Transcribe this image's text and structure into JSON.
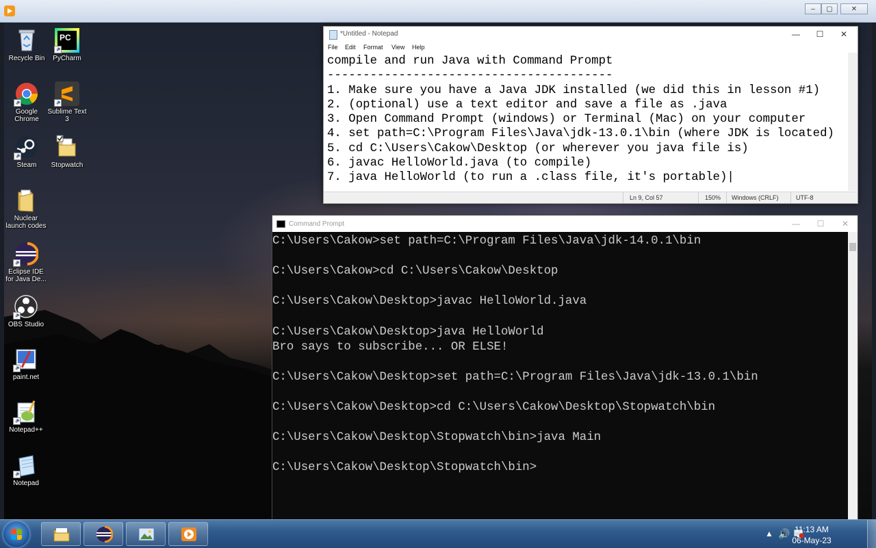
{
  "vm_frame": {
    "minimize": "‒",
    "maximize": "▢",
    "close": "✕"
  },
  "desktop_icons": [
    {
      "name": "recycle-bin",
      "label": "Recycle Bin"
    },
    {
      "name": "pycharm",
      "label": "PyCharm"
    },
    {
      "name": "google-chrome",
      "label": "Google Chrome"
    },
    {
      "name": "sublime-text",
      "label": "Sublime Text 3"
    },
    {
      "name": "steam",
      "label": "Steam"
    },
    {
      "name": "stopwatch",
      "label": "Stopwatch"
    },
    {
      "name": "nuclear-launch-codes",
      "label": "Nuclear launch codes"
    },
    {
      "name": "eclipse-ide",
      "label": "Eclipse IDE for Java De..."
    },
    {
      "name": "obs-studio",
      "label": "OBS Studio"
    },
    {
      "name": "paint-net",
      "label": "paint.net"
    },
    {
      "name": "notepad-plus-plus",
      "label": "Notepad++"
    },
    {
      "name": "notepad",
      "label": "Notepad"
    }
  ],
  "pycharm_badge": "PC",
  "notepad": {
    "title": "*Untitled - Notepad",
    "menu": [
      "File",
      "Edit",
      "Format",
      "View",
      "Help"
    ],
    "content": "compile and run Java with Command Prompt\n----------------------------------------\n1. Make sure you have a Java JDK installed (we did this in lesson #1)\n2. (optional) use a text editor and save a file as .java\n3. Open Command Prompt (windows) or Terminal (Mac) on your computer\n4. set path=C:\\Program Files\\Java\\jdk-13.0.1\\bin (where JDK is located)\n5. cd C:\\Users\\Cakow\\Desktop (or wherever you java file is)\n6. javac HelloWorld.java (to compile)\n7. java HelloWorld (to run a .class file, it's portable)|",
    "status": {
      "position": "Ln 9, Col 57",
      "zoom": "150%",
      "line_ending": "Windows (CRLF)",
      "encoding": "UTF-8"
    }
  },
  "cmd": {
    "title": "Command Prompt",
    "content": "C:\\Users\\Cakow>set path=C:\\Program Files\\Java\\jdk-14.0.1\\bin\n\nC:\\Users\\Cakow>cd C:\\Users\\Cakow\\Desktop\n\nC:\\Users\\Cakow\\Desktop>javac HelloWorld.java\n\nC:\\Users\\Cakow\\Desktop>java HelloWorld\nBro says to subscribe... OR ELSE!\n\nC:\\Users\\Cakow\\Desktop>set path=C:\\Program Files\\Java\\jdk-13.0.1\\bin\n\nC:\\Users\\Cakow\\Desktop>cd C:\\Users\\Cakow\\Desktop\\Stopwatch\\bin\n\nC:\\Users\\Cakow\\Desktop\\Stopwatch\\bin>java Main\n\nC:\\Users\\Cakow\\Desktop\\Stopwatch\\bin>"
  },
  "taskbar": {
    "pinned": [
      "file-explorer",
      "eclipse",
      "photo-viewer",
      "media-player"
    ],
    "clock_time": "11:13 AM",
    "clock_date": "06-May-23"
  }
}
